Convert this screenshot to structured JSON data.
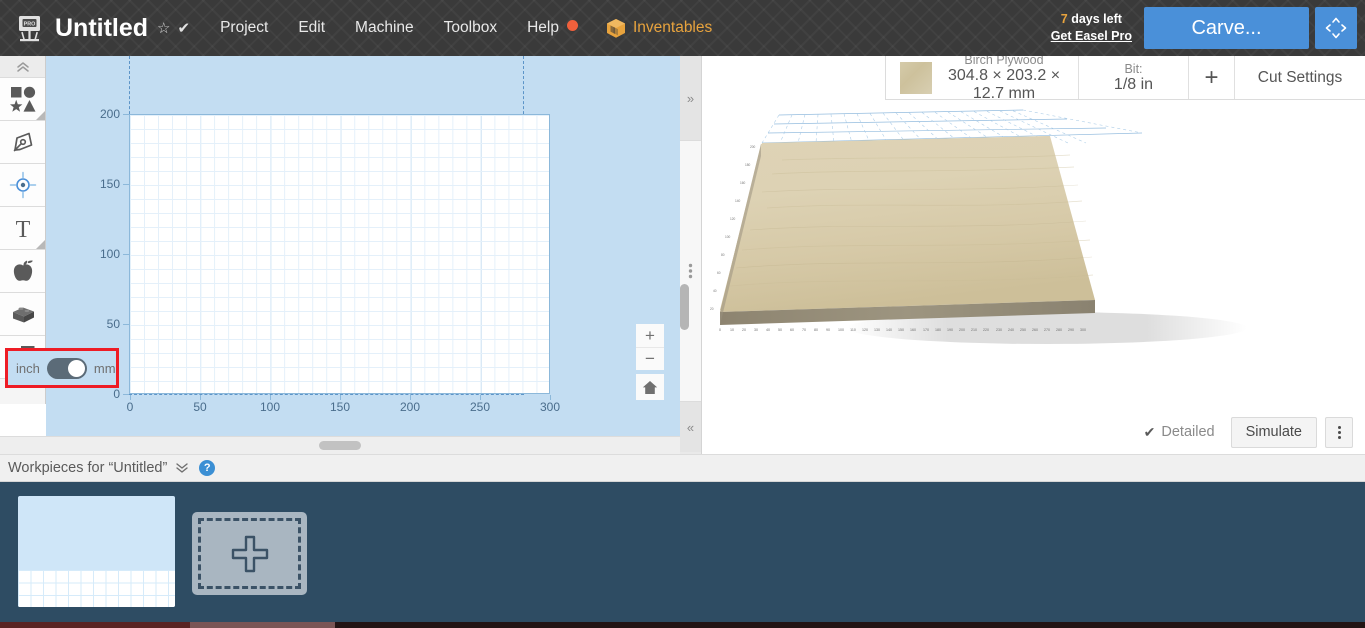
{
  "header": {
    "logo_icon": "easel-pro-logo-icon",
    "title": "Untitled",
    "star_icon": "☆",
    "check_icon": "✔",
    "menu": [
      {
        "label": "Project"
      },
      {
        "label": "Edit"
      },
      {
        "label": "Machine"
      },
      {
        "label": "Toolbox"
      },
      {
        "label": "Help",
        "has_dot": true
      }
    ],
    "inventables_label": "Inventables",
    "trial_days_num": "7",
    "trial_days_text": " days left",
    "trial_link": "Get Easel Pro",
    "carve_label": "Carve...",
    "move_icon": "move-arrows-icon",
    "accent_blue": "#4a90d9",
    "accent_orange": "#e8a33d",
    "help_dot_color": "#f0603c"
  },
  "left_toolbar": {
    "items": [
      {
        "name": "collapse-toolbar",
        "icon": "chevron-up-double-icon",
        "label": ""
      },
      {
        "name": "shapes",
        "icon": "shapes-icon",
        "label": "Shapes"
      },
      {
        "name": "pen-tool",
        "icon": "pen-nib-icon",
        "label": "Draw"
      },
      {
        "name": "center-point",
        "icon": "target-crosshair-icon",
        "label": "Center"
      },
      {
        "name": "text-tool",
        "icon": "text-T-icon",
        "label": "Text"
      },
      {
        "name": "apps",
        "icon": "apple-icon",
        "label": "Apps"
      },
      {
        "name": "three-d",
        "icon": "brick-block-icon",
        "label": "3D"
      },
      {
        "name": "import",
        "icon": "import-arrow-icon",
        "label": "Import"
      }
    ]
  },
  "canvas": {
    "units_inch": "inch",
    "units_mm": "mm",
    "units_selected": "mm",
    "x_axis_ticks": [
      "0",
      "50",
      "100",
      "150",
      "200",
      "250",
      "300"
    ],
    "y_axis_ticks": [
      "0",
      "50",
      "100",
      "150",
      "200"
    ],
    "zoom_in": "+",
    "zoom_out": "−",
    "home_icon": "home-icon",
    "grid_minor_step": 10,
    "grid_major_step": 50,
    "highlight_box_color": "#ee1c25"
  },
  "splitter": {
    "expand_right_icon": "»",
    "drag_handle_icon": "⋮",
    "collapse_icon": "«"
  },
  "preview": {
    "material": {
      "name": "Birch Plywood",
      "dimensions": "304.8 × 203.2 × 12.7 mm",
      "swatch_color": "#cfc39c"
    },
    "bit": {
      "label": "Bit:",
      "value": "1/8 in"
    },
    "add_bit_icon": "+",
    "cut_settings_label": "Cut Settings",
    "detailed_label": "Detailed",
    "detailed_checked": true,
    "simulate_label": "Simulate",
    "more_icon": "vertical-dots-icon",
    "board_tick_labels": [
      "0",
      "10",
      "20",
      "30",
      "40",
      "50",
      "60",
      "70",
      "80",
      "90",
      "100",
      "110",
      "120",
      "130",
      "140",
      "150",
      "160",
      "170",
      "180",
      "190",
      "200",
      "210",
      "220",
      "230",
      "240",
      "250",
      "260",
      "270",
      "280",
      "290",
      "300"
    ]
  },
  "workpieces": {
    "header_title": "Workpieces for “Untitled”",
    "caret_icon": "chevron-down-double-icon",
    "help_icon": "?",
    "items": [
      {
        "name": "workpiece-thumbnail-1",
        "selected": true
      }
    ],
    "add_label": "+",
    "tray_color": "#2e4c63"
  }
}
